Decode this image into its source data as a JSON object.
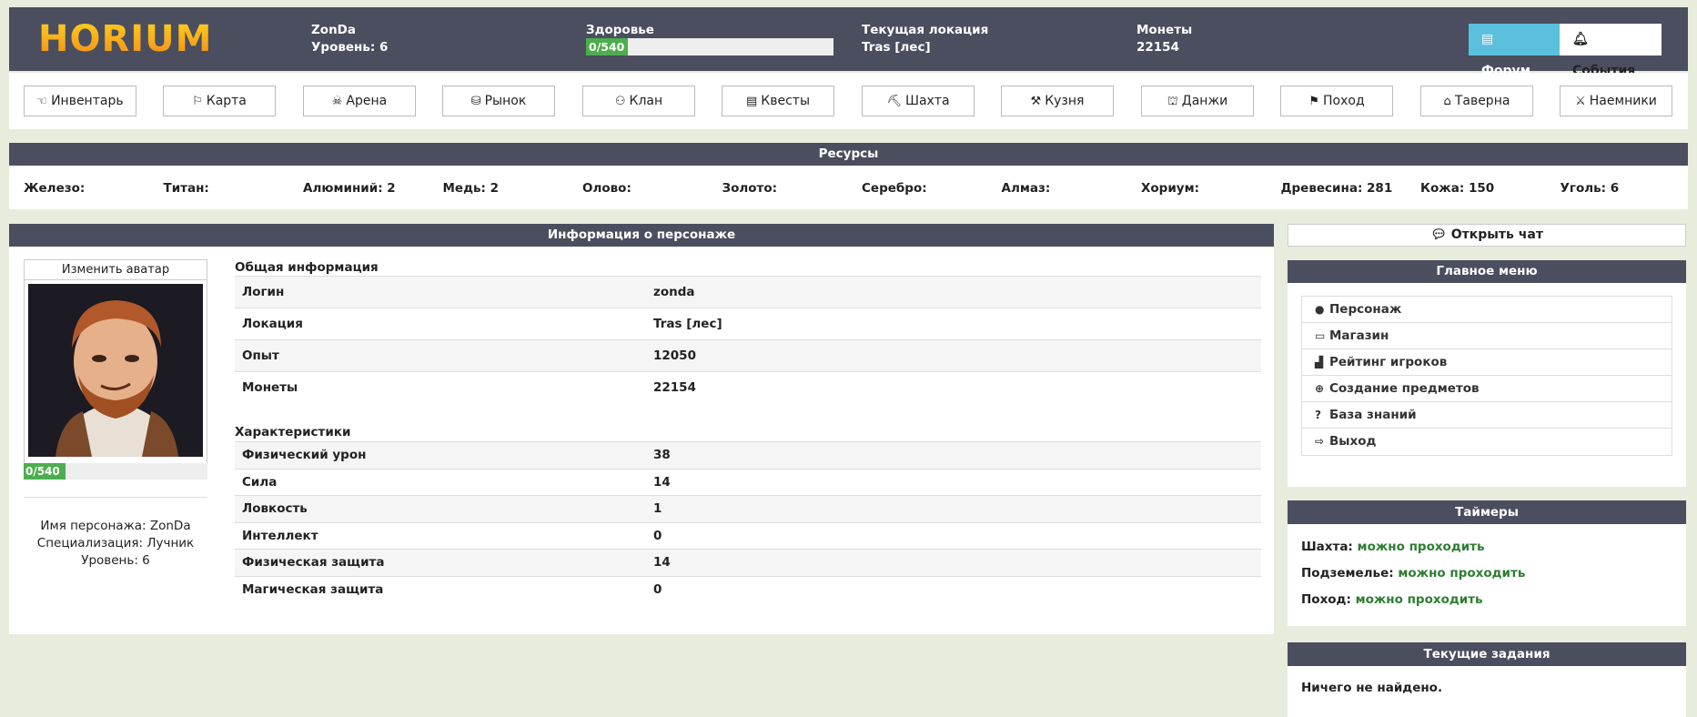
{
  "header": {
    "logo": "HORIUM",
    "player_name": "ZonDa",
    "level_label": "Уровень: 6",
    "health_label": "Здоровье",
    "health_value": "0/540",
    "health_fraction": 0.0,
    "location_label": "Текущая локация",
    "location_value": "Tras [лес]",
    "coins_label": "Монеты",
    "coins_value": "22154",
    "forum_label": "Форум",
    "events_label": "События"
  },
  "nav": [
    {
      "label": "Инвентарь",
      "icon": "hand-icon",
      "glyph": "☜"
    },
    {
      "label": "Карта",
      "icon": "signpost-icon",
      "glyph": "⚐"
    },
    {
      "label": "Арена",
      "icon": "skull-icon",
      "glyph": "☠"
    },
    {
      "label": "Рынок",
      "icon": "coins-icon",
      "glyph": "⛁"
    },
    {
      "label": "Клан",
      "icon": "users-icon",
      "glyph": "⚇"
    },
    {
      "label": "Квесты",
      "icon": "clipboard-icon",
      "glyph": "▤"
    },
    {
      "label": "Шахта",
      "icon": "pickaxe-icon",
      "glyph": "⛏"
    },
    {
      "label": "Кузня",
      "icon": "anvil-icon",
      "glyph": "⚒"
    },
    {
      "label": "Данжи",
      "icon": "dungeon-icon",
      "glyph": "⛫"
    },
    {
      "label": "Поход",
      "icon": "hiking-icon",
      "glyph": "⚑"
    },
    {
      "label": "Таверна",
      "icon": "store-icon",
      "glyph": "⌂"
    },
    {
      "label": "Наемники",
      "icon": "person-digging-icon",
      "glyph": "⚔"
    }
  ],
  "resources": {
    "title": "Ресурсы",
    "items": [
      "Железо:",
      "Титан:",
      "Алюминий: 2",
      "Медь: 2",
      "Олово:",
      "Золото:",
      "Серебро:",
      "Алмаз:",
      "Хориум:",
      "Древесина: 281",
      "Кожа: 150",
      "Уголь: 6"
    ]
  },
  "info": {
    "title": "Информация о персонаже",
    "change_avatar": "Изменить аватар",
    "avatar_hp": "0/540",
    "char_name": "Имя персонажа: ZonDa",
    "char_spec": "Специализация: Лучник",
    "char_level": "Уровень: 6",
    "general_title": "Общая информация",
    "general": [
      {
        "k": "Логин",
        "v": "zonda"
      },
      {
        "k": "Локация",
        "v": "Tras [лес]"
      },
      {
        "k": "Опыт",
        "v": "12050"
      },
      {
        "k": "Монеты",
        "v": "22154"
      }
    ],
    "stats_title": "Характеристики",
    "stats": [
      {
        "k": "Физический урон",
        "v": "38"
      },
      {
        "k": "Сила",
        "v": "14"
      },
      {
        "k": "Ловкость",
        "v": "1"
      },
      {
        "k": "Интеллект",
        "v": "0"
      },
      {
        "k": "Физическая защита",
        "v": "14"
      },
      {
        "k": "Магическая защита",
        "v": "0"
      }
    ]
  },
  "sidebar": {
    "chat_label": "Открыть чат",
    "menu_title": "Главное меню",
    "menu": [
      {
        "label": "Персонаж",
        "icon": "user-icon",
        "glyph": "●"
      },
      {
        "label": "Магазин",
        "icon": "store-icon",
        "glyph": "▭"
      },
      {
        "label": "Рейтинг игроков",
        "icon": "ranking-icon",
        "glyph": "▟"
      },
      {
        "label": "Создание предметов",
        "icon": "plus-circle-icon",
        "glyph": "⊕"
      },
      {
        "label": "База знаний",
        "icon": "question-circle-icon",
        "glyph": "?"
      },
      {
        "label": "Выход",
        "icon": "logout-icon",
        "glyph": "⇨"
      }
    ],
    "timers_title": "Таймеры",
    "timers": [
      {
        "label": "Шахта:",
        "status": "можно проходить"
      },
      {
        "label": "Подземелье:",
        "status": "можно проходить"
      },
      {
        "label": "Поход:",
        "status": "можно проходить"
      }
    ],
    "tasks_title": "Текущие задания",
    "tasks_empty": "Ничего не найдено."
  }
}
